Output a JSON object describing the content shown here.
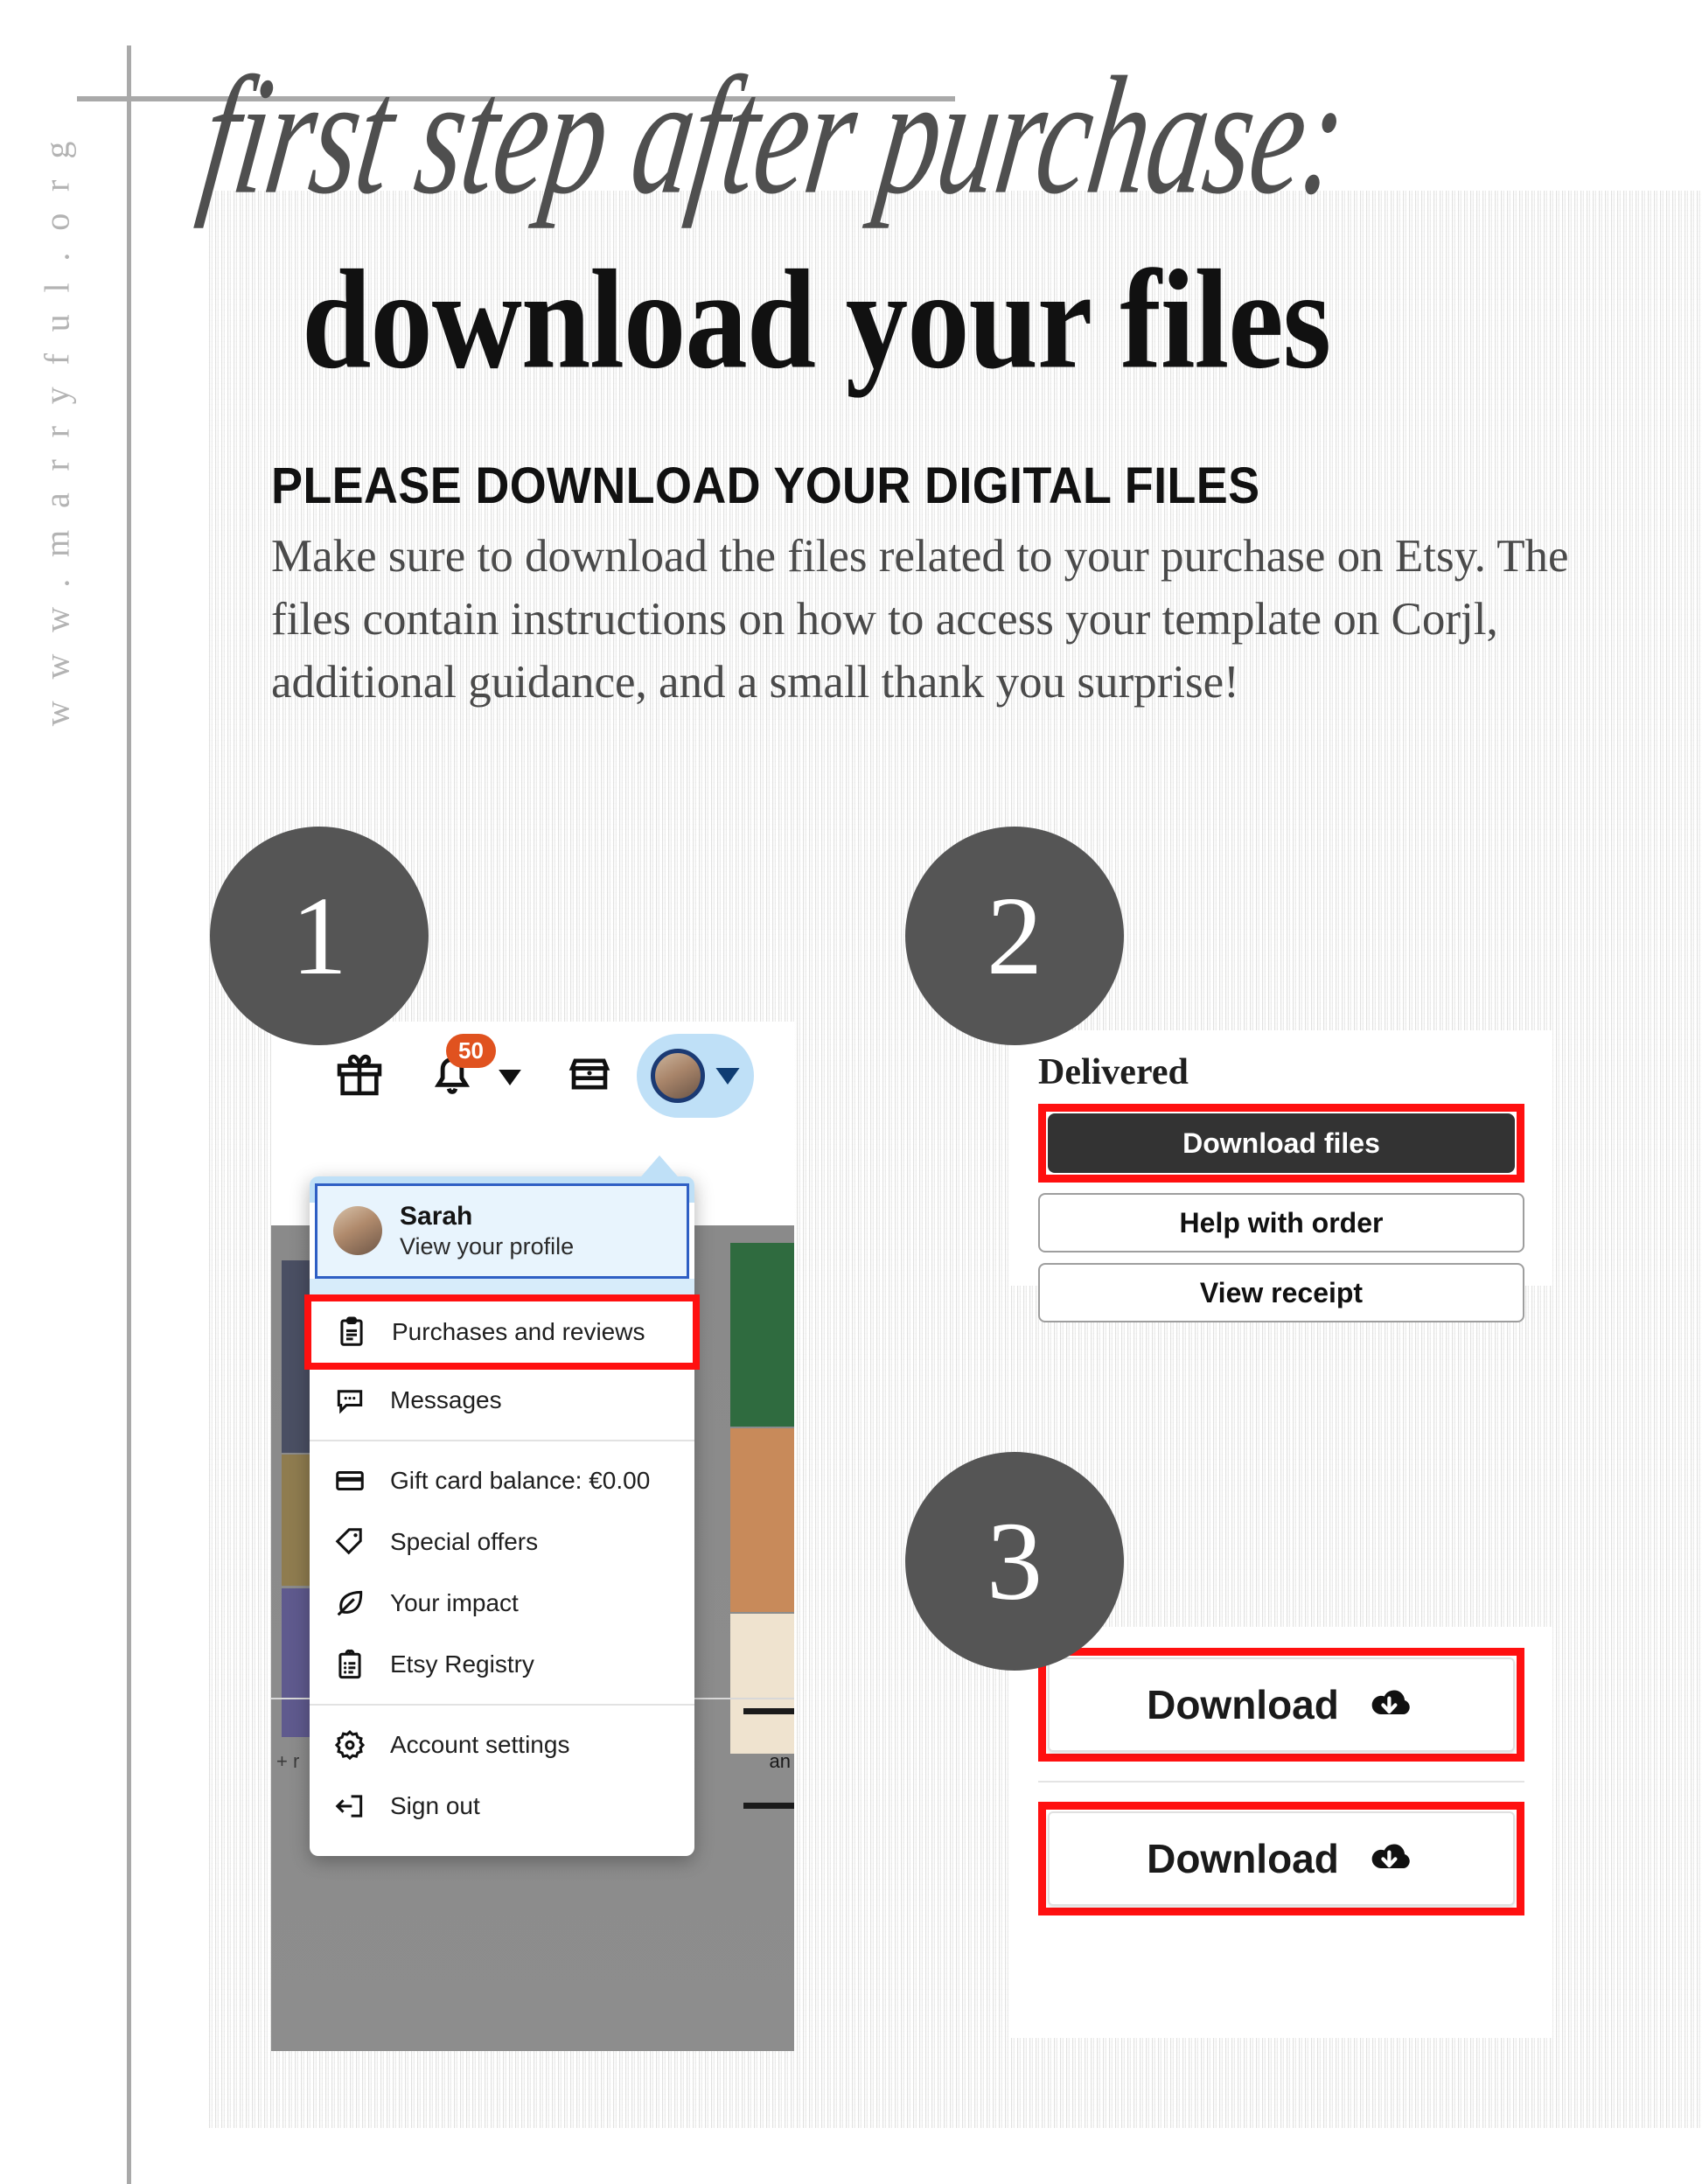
{
  "page": {
    "script_title": "first step after purchase:",
    "main_title": "download your files",
    "subheading": "PLEASE DOWNLOAD YOUR DIGITAL FILES",
    "body_copy": "Make sure to download the files related to your purchase on Etsy. The files contain instructions on how to access your template on Corjl, additional guidance, and a small thank you surprise!",
    "site_url": "www.marryful.org"
  },
  "steps": {
    "one": "1",
    "two": "2",
    "three": "3"
  },
  "colors": {
    "highlight_red": "#ff1010",
    "step_circle": "#555555",
    "badge_orange": "#e0521f",
    "avatar_pill_blue": "#bfe0f7",
    "profile_border_blue": "#2f5fc4",
    "primary_button": "#333333",
    "rule_gray": "#a9a9a9",
    "body_text": "#4a4a4a"
  },
  "step1": {
    "toolbar": {
      "gift_icon": "gift-icon",
      "bell_icon": "bell-icon",
      "bell_badge": "50",
      "bell_caret_icon": "caret-down-icon",
      "shop_icon": "shop-icon",
      "avatar_icon": "avatar-icon",
      "avatar_caret_icon": "caret-down-icon"
    },
    "profile": {
      "name": "Sarah",
      "subtitle": "View your profile"
    },
    "menu_items": [
      {
        "label": "Purchases and reviews",
        "icon": "clipboard-icon",
        "highlighted": true
      },
      {
        "label": "Messages",
        "icon": "chat-bubble-icon",
        "highlighted": false
      },
      {
        "label": "Gift card balance: €0.00",
        "icon": "credit-card-icon",
        "highlighted": false
      },
      {
        "label": "Special offers",
        "icon": "tag-icon",
        "highlighted": false
      },
      {
        "label": "Your impact",
        "icon": "leaf-icon",
        "highlighted": false
      },
      {
        "label": "Etsy Registry",
        "icon": "registry-clipboard-icon",
        "highlighted": false
      },
      {
        "label": "Account settings",
        "icon": "gear-icon",
        "highlighted": false
      },
      {
        "label": "Sign out",
        "icon": "sign-out-icon",
        "highlighted": false
      }
    ],
    "background_text_left": "+ r",
    "background_text_right": "an"
  },
  "step2": {
    "status_label": "Delivered",
    "buttons": [
      {
        "label": "Download files",
        "style": "primary",
        "highlighted": true
      },
      {
        "label": "Help with order",
        "style": "secondary",
        "highlighted": false
      },
      {
        "label": "View receipt",
        "style": "secondary",
        "highlighted": false
      }
    ]
  },
  "step3": {
    "buttons": [
      {
        "label": "Download",
        "icon": "cloud-download-icon",
        "highlighted": true
      },
      {
        "label": "Download",
        "icon": "cloud-download-icon",
        "highlighted": true
      }
    ]
  }
}
